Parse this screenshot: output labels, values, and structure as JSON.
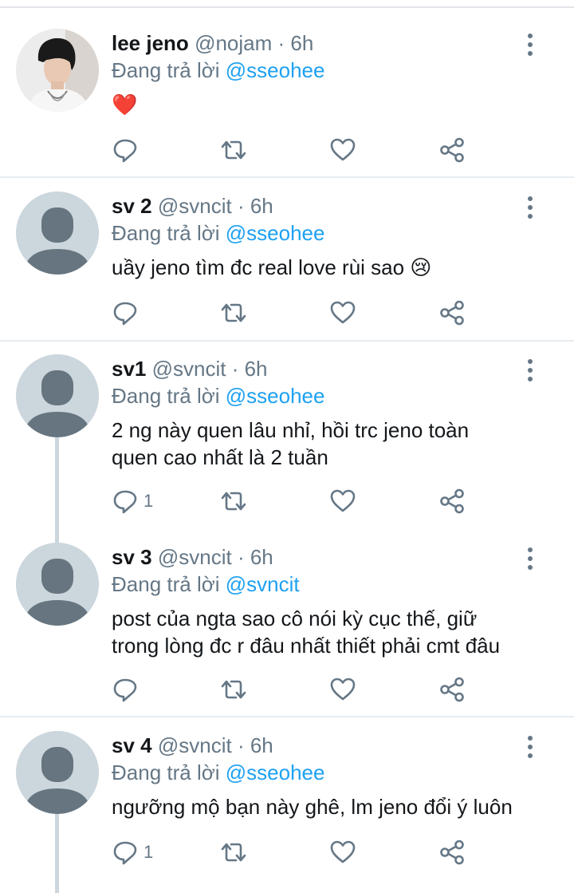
{
  "tweets": [
    {
      "name": "lee jeno",
      "handle": "@nojam",
      "time": "· 6h",
      "reply_prefix": "Đang trả lời ",
      "reply_to": "@sseohee",
      "lines": [
        "❤️"
      ],
      "reply_count": "",
      "avatar": "photo"
    },
    {
      "name": "sv 2",
      "handle": "@svncit",
      "time": "· 6h",
      "reply_prefix": "Đang trả lời ",
      "reply_to": "@sseohee",
      "lines": [
        "uầy jeno tìm đc real love rùi sao 😢"
      ],
      "reply_count": "",
      "avatar": "default"
    },
    {
      "name": "sv1",
      "handle": "@svncit",
      "time": "· 6h",
      "reply_prefix": "Đang trả lời ",
      "reply_to": "@sseohee",
      "lines": [
        "2 ng này quen lâu nhỉ, hồi trc jeno toàn",
        "quen cao nhất là 2 tuần"
      ],
      "reply_count": "1",
      "avatar": "default"
    },
    {
      "name": "sv 3",
      "handle": "@svncit",
      "time": "· 6h",
      "reply_prefix": "Đang trả lời ",
      "reply_to": "@svncit",
      "lines": [
        "post của ngta sao cô nói kỳ cục thế, giữ",
        "trong lòng đc r đâu nhất thiết phải cmt đâu"
      ],
      "reply_count": "",
      "avatar": "default"
    },
    {
      "name": "sv 4",
      "handle": "@svncit",
      "time": "· 6h",
      "reply_prefix": "Đang trả lời ",
      "reply_to": "@sseohee",
      "lines": [
        "ngưỡng mộ bạn này ghê, lm jeno đổi ý luôn"
      ],
      "reply_count": "1",
      "avatar": "default"
    }
  ],
  "icons": {
    "reply": "reply-icon",
    "retweet": "retweet-icon",
    "like": "heart-icon",
    "share": "share-icon",
    "more": "more-vertical-icon"
  },
  "colors": {
    "mention": "#1da1f2",
    "muted": "#657786",
    "default_avatar": "#ccd6dd",
    "default_avatar_figure": "#66757f"
  }
}
